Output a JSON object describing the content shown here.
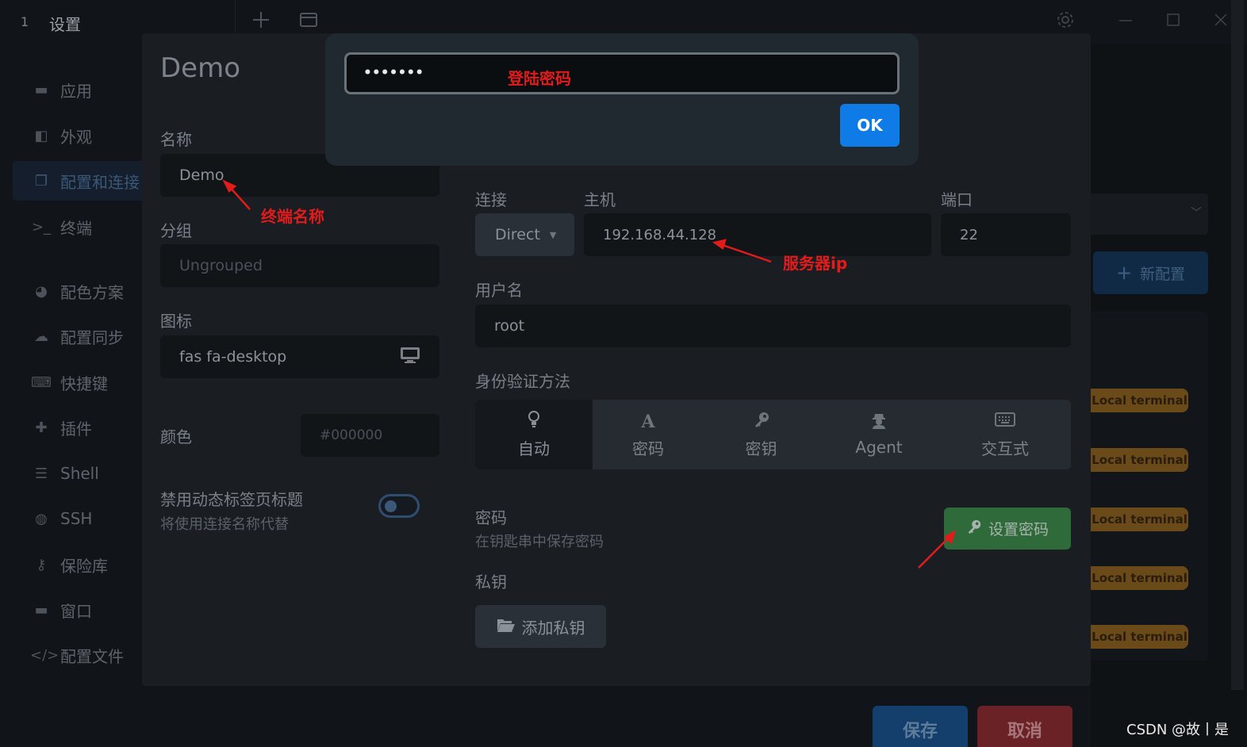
{
  "titlebar": {
    "tab_number": "1",
    "tab_title": "设置",
    "new_tab_icon": "plus-icon",
    "window_icon": "window-icon",
    "settings_icon": "gear-icon",
    "minimize_icon": "minimize-icon",
    "maximize_icon": "maximize-icon",
    "close_icon": "close-icon"
  },
  "sidebar": {
    "items": [
      {
        "label": "应用",
        "icon": "window-icon"
      },
      {
        "label": "外观",
        "icon": "paint-icon"
      },
      {
        "label": "配置和连接",
        "icon": "copy-icon",
        "active": true
      },
      {
        "label": "终端",
        "icon": "terminal-icon"
      },
      {
        "label": "配色方案",
        "icon": "palette-icon"
      },
      {
        "label": "配置同步",
        "icon": "cloud-icon"
      },
      {
        "label": "快捷键",
        "icon": "keyboard-icon"
      },
      {
        "label": "插件",
        "icon": "puzzle-icon"
      },
      {
        "label": "Shell",
        "icon": "list-icon"
      },
      {
        "label": "SSH",
        "icon": "globe-icon"
      },
      {
        "label": "保险库",
        "icon": "key-icon"
      },
      {
        "label": "窗口",
        "icon": "window-icon"
      },
      {
        "label": "配置文件",
        "icon": "code-icon"
      }
    ]
  },
  "profile": {
    "heading": "Demo",
    "name_label": "名称",
    "name_value": "Demo",
    "group_label": "分组",
    "group_placeholder": "Ungrouped",
    "icon_label": "图标",
    "icon_value": "fas fa-desktop",
    "color_label": "颜色",
    "color_placeholder": "#000000",
    "dynamic_title_label": "禁用动态标签页标题",
    "dynamic_title_hint": "将使用连接名称代替"
  },
  "connection": {
    "connect_label": "连接",
    "connect_value": "Direct",
    "host_label": "主机",
    "host_value": "192.168.44.128",
    "port_label": "端口",
    "port_value": "22",
    "username_label": "用户名",
    "username_value": "root",
    "auth_label": "身份验证方法",
    "auth_options": [
      {
        "label": "自动",
        "icon": "lightbulb-icon",
        "active": true
      },
      {
        "label": "密码",
        "icon": "font-a-icon"
      },
      {
        "label": "密钥",
        "icon": "key-icon"
      },
      {
        "label": "Agent",
        "icon": "user-secret-icon"
      },
      {
        "label": "交互式",
        "icon": "keyboard-icon"
      }
    ],
    "password_label": "密码",
    "password_hint": "在钥匙串中保存密码",
    "set_password_button": "设置密码",
    "private_key_label": "私钥",
    "add_key_button": "添加私钥"
  },
  "footer": {
    "save": "保存",
    "cancel": "取消"
  },
  "background": {
    "new_config_button": "新配置",
    "badge_label": "Local terminal",
    "badge_count": 5
  },
  "prompt": {
    "password_value": "•••••••",
    "ok_button": "OK"
  },
  "annotations": {
    "login_password": "登陆密码",
    "terminal_name": "终端名称",
    "server_ip": "服务器ip"
  },
  "watermark": "CSDN @故丨是",
  "colors": {
    "accent_blue": "#0f7be6",
    "annotation_red": "#e21b1b",
    "set_password_green": "#2f6a3a",
    "save_blue": "#143e6b",
    "cancel_red": "#6a2227"
  }
}
